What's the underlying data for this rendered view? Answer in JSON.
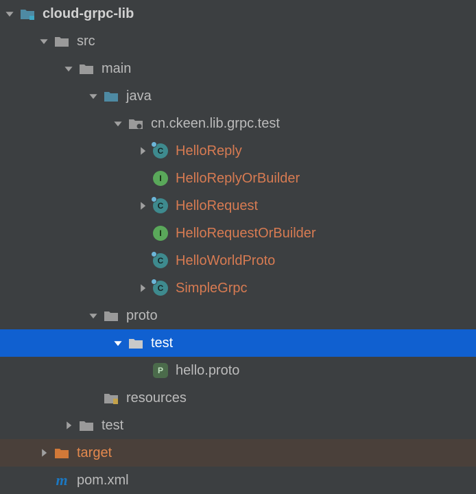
{
  "tree": {
    "root": {
      "label": "cloud-grpc-lib",
      "src": {
        "label": "src"
      },
      "main": {
        "label": "main"
      },
      "java": {
        "label": "java"
      },
      "pkg": {
        "label": "cn.ckeen.lib.grpc.test"
      },
      "classes": {
        "helloReply": "HelloReply",
        "helloReplyOrBuilder": "HelloReplyOrBuilder",
        "helloRequest": "HelloRequest",
        "helloRequestOrBuilder": "HelloRequestOrBuilder",
        "helloWorldProto": "HelloWorldProto",
        "simpleGrpc": "SimpleGrpc"
      },
      "proto": {
        "label": "proto"
      },
      "protoTest": {
        "label": "test"
      },
      "protoFile": {
        "label": "hello.proto"
      },
      "resources": {
        "label": "resources"
      },
      "testDir": {
        "label": "test"
      },
      "target": {
        "label": "target"
      },
      "pom": {
        "label": "pom.xml"
      }
    }
  },
  "colors": {
    "module_folder": "#4e8aa3",
    "folder": "#9a9a9a",
    "src_folder": "#4e8aa3",
    "package_folder": "#9a9a9a",
    "resources_folder": "#9a9a9a",
    "target_folder": "#d27938"
  }
}
